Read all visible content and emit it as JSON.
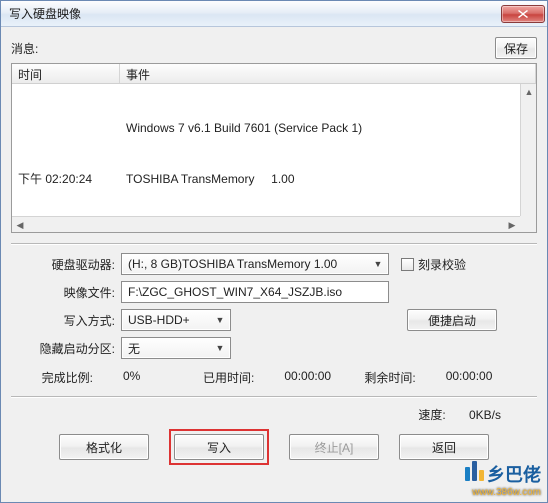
{
  "titlebar": {
    "title": "写入硬盘映像"
  },
  "top": {
    "message_label": "消息:",
    "save_label": "保存"
  },
  "list": {
    "col_time": "时间",
    "col_event": "事件",
    "rows": [
      {
        "time": "",
        "event": "Windows 7 v6.1 Build 7601 (Service Pack 1)"
      },
      {
        "time": "下午 02:20:24",
        "event": "TOSHIBA TransMemory     1.00"
      }
    ]
  },
  "form": {
    "drive_label": "硬盘驱动器:",
    "drive_value": "(H:, 8 GB)TOSHIBA TransMemory     1.00",
    "burn_verify_label": "刻录校验",
    "image_label": "映像文件:",
    "image_value": "F:\\ZGC_GHOST_WIN7_X64_JSZJB.iso",
    "write_mode_label": "写入方式:",
    "write_mode_value": "USB-HDD+",
    "quick_boot_label": "便捷启动",
    "hidden_partition_label": "隐藏启动分区:",
    "hidden_partition_value": "无"
  },
  "stats": {
    "percent_label": "完成比例:",
    "percent_value": "0%",
    "elapsed_label": "已用时间:",
    "elapsed_value": "00:00:00",
    "remain_label": "剩余时间:",
    "remain_value": "00:00:00",
    "speed_label": "速度:",
    "speed_value": "0KB/s"
  },
  "buttons": {
    "format": "格式化",
    "write": "写入",
    "abort": "终止[A]",
    "back": "返回"
  },
  "watermark": {
    "text": "乡巴佬",
    "url": "www.386w.com"
  }
}
